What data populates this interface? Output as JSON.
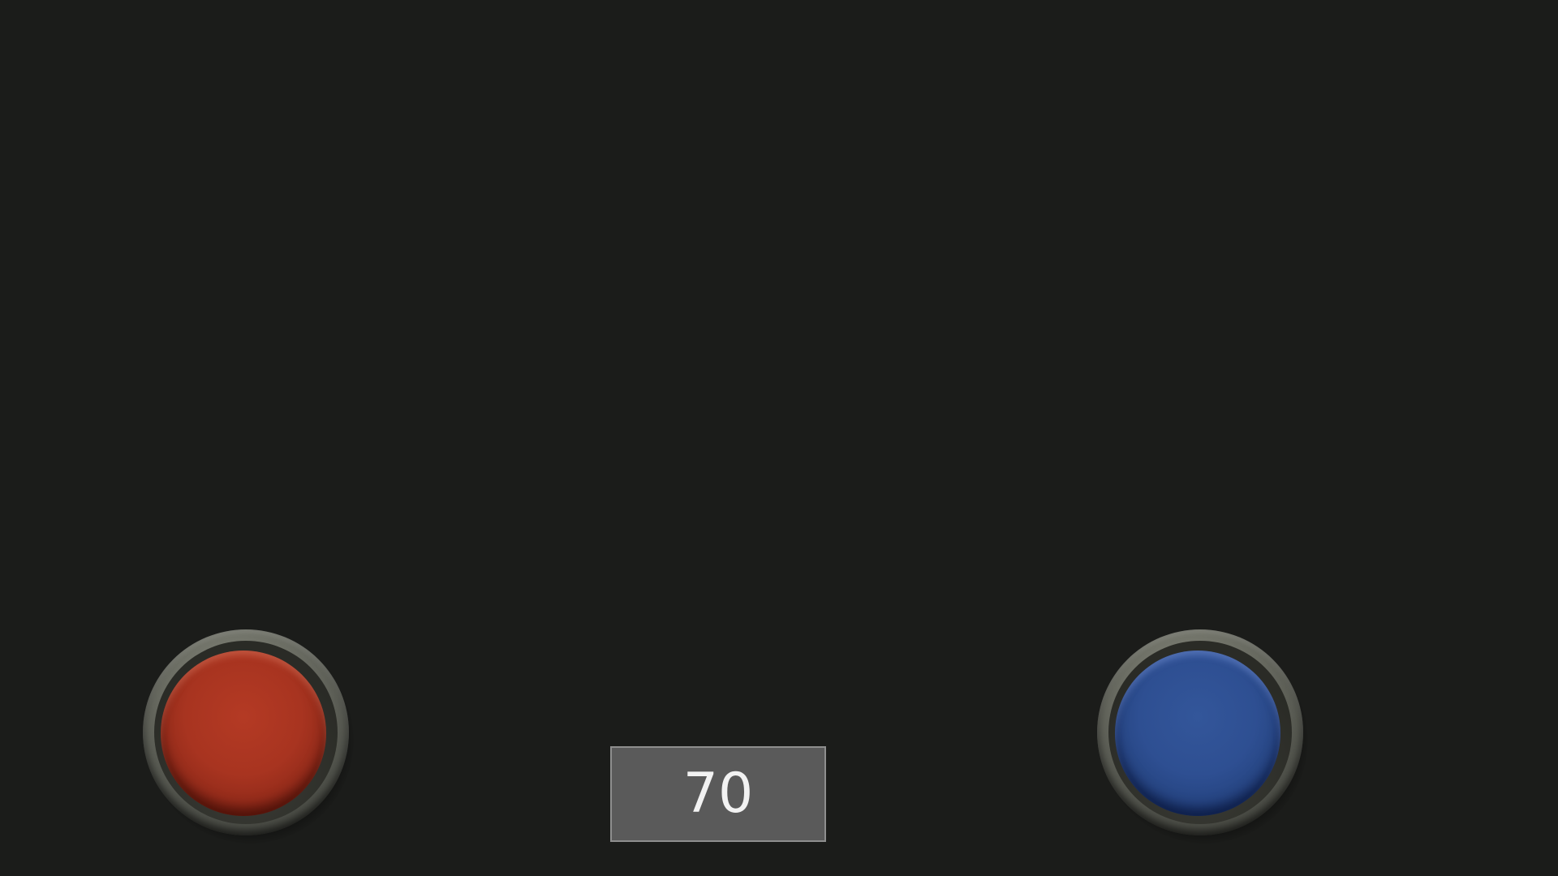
{
  "counter": {
    "value": "70"
  },
  "buttons": {
    "left": {
      "color": "red",
      "accent": "#a83420"
    },
    "right": {
      "color": "blue",
      "accent": "#2e4f92"
    }
  },
  "theme": {
    "background": "#1b1c1a",
    "counter_background": "#5a5a5a",
    "counter_border": "#8e8e8e"
  }
}
